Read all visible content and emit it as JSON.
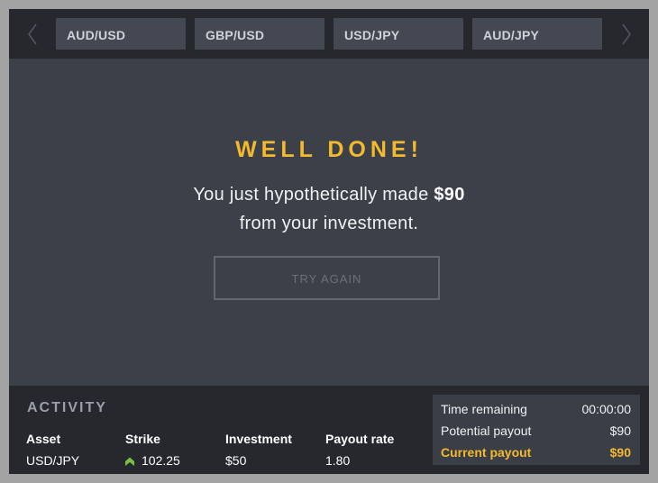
{
  "tabs": [
    "AUD/USD",
    "GBP/USD",
    "USD/JPY",
    "AUD/JPY"
  ],
  "icons": {
    "prev": "chevron-left-icon",
    "next": "chevron-right-icon",
    "strike_direction": "arrow-up-icon"
  },
  "result": {
    "headline": "WELL DONE!",
    "line1_prefix": "You just hypothetically made ",
    "amount": "$90",
    "line2": "from your investment.",
    "button": "TRY AGAIN"
  },
  "activity": {
    "title": "ACTIVITY",
    "headers": {
      "asset": "Asset",
      "strike": "Strike",
      "investment": "Investment",
      "payout_rate": "Payout rate"
    },
    "row": {
      "asset": "USD/JPY",
      "strike": "102.25",
      "investment": "$50",
      "payout_rate": "1.80"
    }
  },
  "summary": {
    "time_remaining_label": "Time remaining",
    "time_remaining": "00:00:00",
    "potential_payout_label": "Potential payout",
    "potential_payout": "$90",
    "current_payout_label": "Current payout",
    "current_payout": "$90"
  },
  "colors": {
    "accent": "#f4b92c",
    "up_arrow": "#7ac143",
    "panel": "#3c4049",
    "bar": "#26282d"
  }
}
